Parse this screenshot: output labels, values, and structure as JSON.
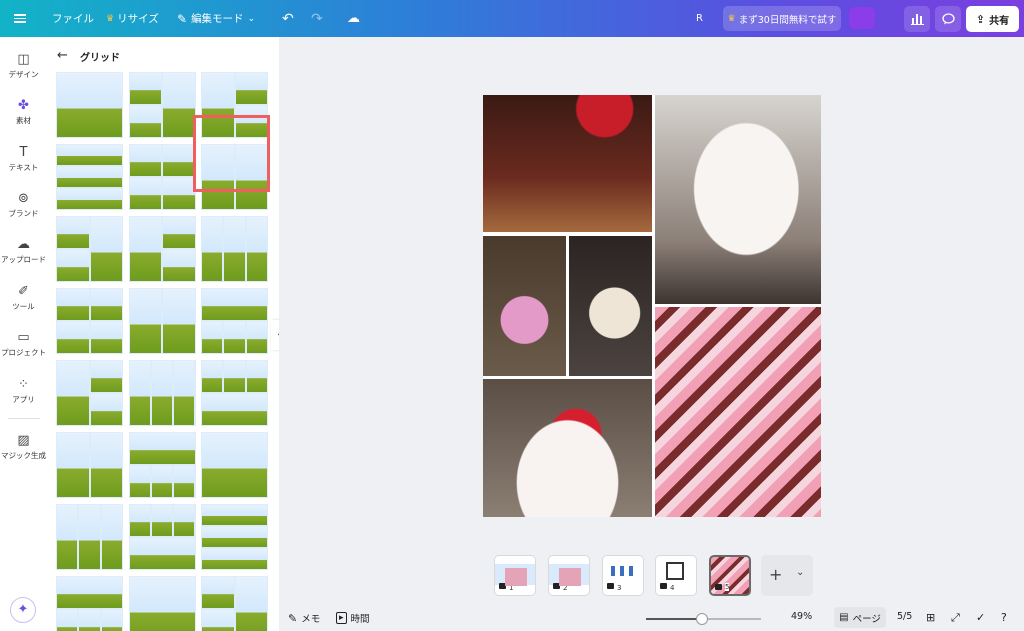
{
  "topbar": {
    "file_label": "ファイル",
    "resize_label": "リサイズ",
    "edit_mode_label": "編集モード",
    "avatar_initial": "R",
    "trial_label": "まず30日間無料で試す",
    "share_label": "共有",
    "accent_color": "#7b3fe0"
  },
  "rail": {
    "items": [
      {
        "label": "デザイン",
        "icon": "layout-icon"
      },
      {
        "label": "素材",
        "icon": "elements-icon"
      },
      {
        "label": "テキスト",
        "icon": "text-icon"
      },
      {
        "label": "ブランド",
        "icon": "brand-icon"
      },
      {
        "label": "アップロード",
        "icon": "upload-cloud-icon"
      },
      {
        "label": "ツール",
        "icon": "draw-tool-icon"
      },
      {
        "label": "プロジェクト",
        "icon": "folder-icon"
      },
      {
        "label": "アプリ",
        "icon": "apps-icon"
      },
      {
        "label": "マジック生成",
        "icon": "magic-generate-icon"
      }
    ]
  },
  "panel": {
    "title": "グリッド",
    "back_icon": "arrow-left-icon"
  },
  "strip": {
    "pages": [
      "1",
      "2",
      "3",
      "4",
      "5"
    ]
  },
  "bottombar": {
    "notes_label": "メモ",
    "timer_label": "時間",
    "zoom_level": "49%",
    "zoom_value": 49,
    "page_view_label": "ページ",
    "page_counter": "5/5"
  }
}
